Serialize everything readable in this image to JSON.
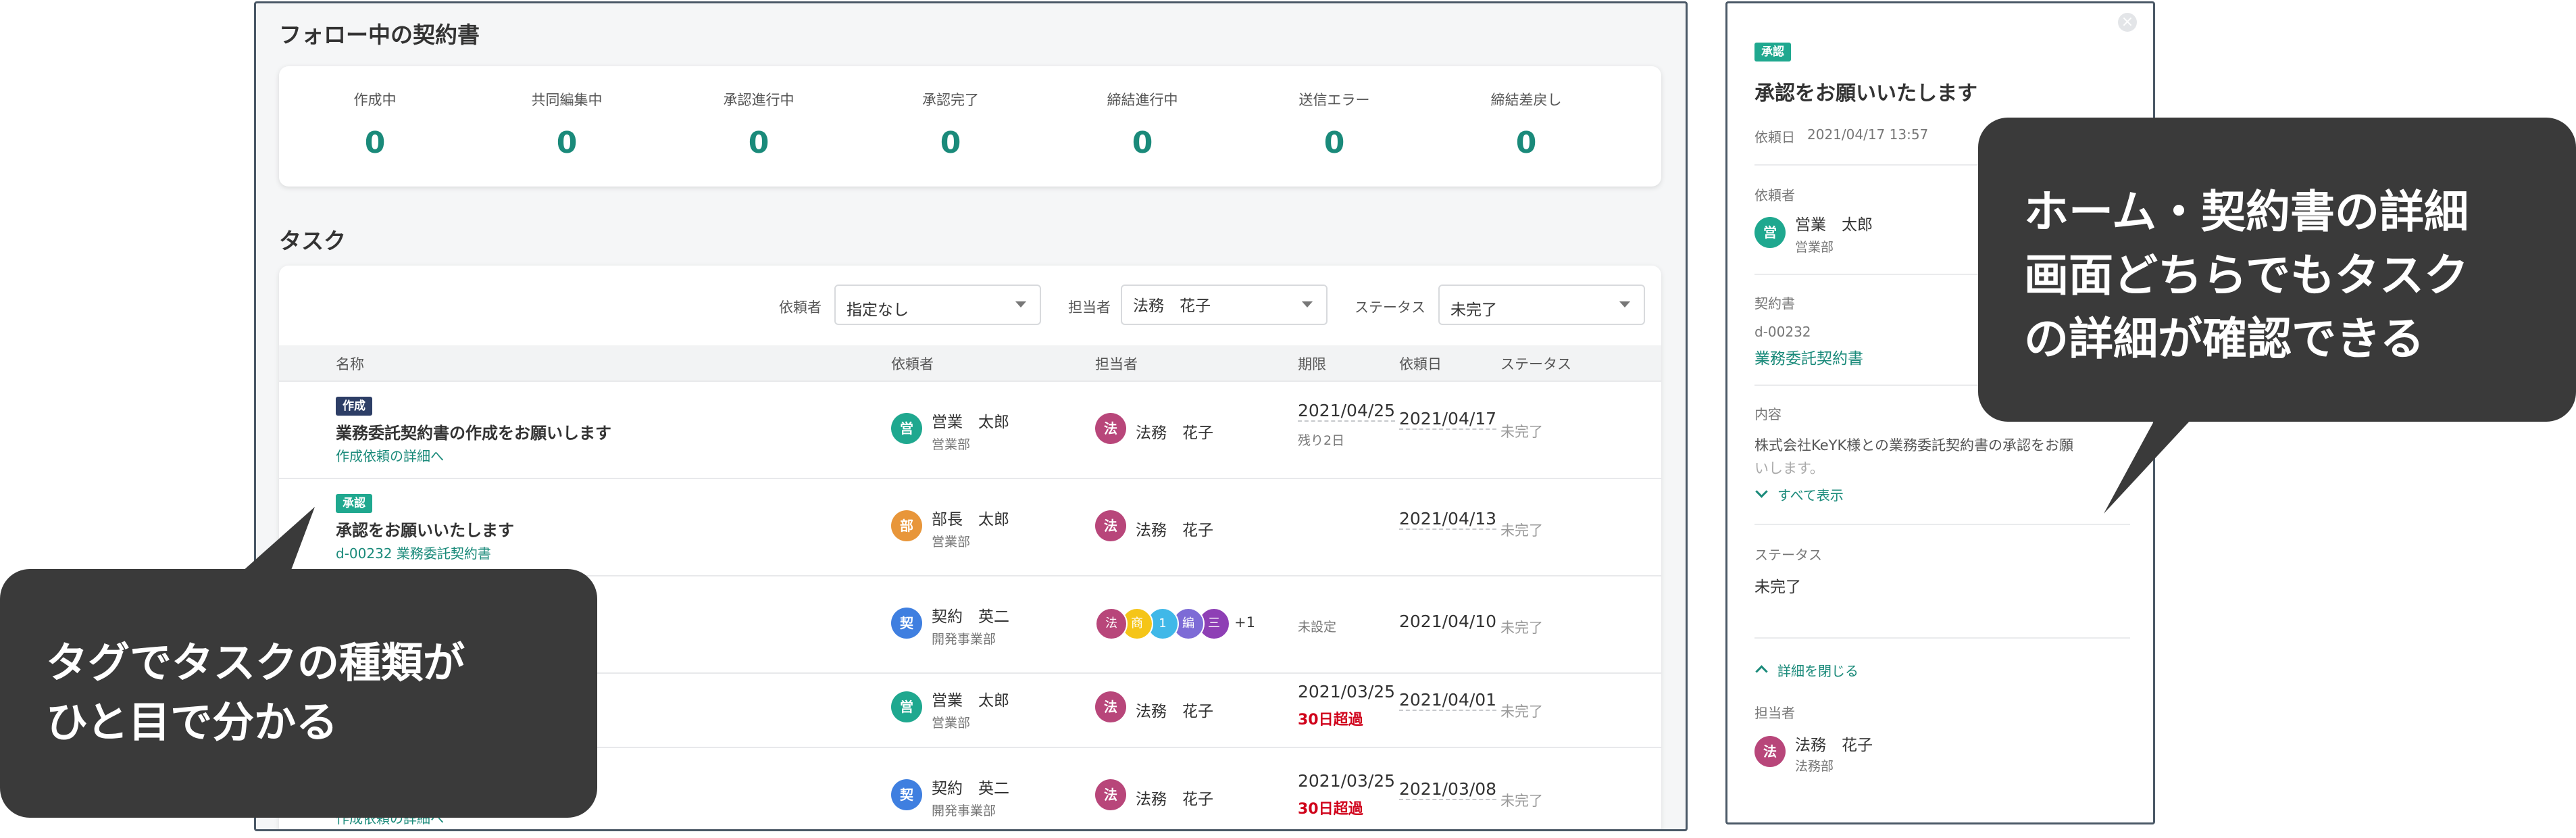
{
  "follow": {
    "title": "フォロー中の契約書",
    "stats": [
      {
        "label": "作成中",
        "count": "0"
      },
      {
        "label": "共同編集中",
        "count": "0"
      },
      {
        "label": "承認進行中",
        "count": "0"
      },
      {
        "label": "承認完了",
        "count": "0"
      },
      {
        "label": "締結進行中",
        "count": "0"
      },
      {
        "label": "送信エラー",
        "count": "0"
      },
      {
        "label": "締結差戻し",
        "count": "0"
      }
    ]
  },
  "tasks": {
    "title": "タスク",
    "filters": {
      "requester_label": "依頼者",
      "requester_value": "指定なし",
      "assignee_label": "担当者",
      "assignee_value": "法務　花子",
      "status_label": "ステータス",
      "status_value": "未完了"
    },
    "columns": [
      "名称",
      "依頼者",
      "担当者",
      "期限",
      "依頼日",
      "ステータス"
    ],
    "rows": [
      {
        "tag": "作成",
        "name": "業務委託契約書の作成をお願いします",
        "link": "作成依頼の詳細へ",
        "req_avatar": "営",
        "req_name": "営業　太郎",
        "req_dept": "営業部",
        "asg_avatar": "法",
        "asg_name": "法務　花子",
        "due": "2021/04/25",
        "due_note": "残り2日",
        "requested": "2021/04/17",
        "status": "未完了"
      },
      {
        "tag": "承認",
        "name": "承認をお願いいたします",
        "link": "d-00232 業務委託契約書",
        "req_avatar": "部",
        "req_name": "部長　太郎",
        "req_dept": "営業部",
        "asg_avatar": "法",
        "asg_name": "法務　花子",
        "requested": "2021/04/13",
        "status": "未完了"
      },
      {
        "req_avatar": "契",
        "req_name": "契約　英二",
        "req_dept": "開発事業部",
        "chips": [
          "法",
          "商",
          "1",
          "編",
          "三"
        ],
        "more": "+1",
        "due": "未設定",
        "requested": "2021/04/10",
        "status": "未完了"
      },
      {
        "req_avatar": "営",
        "req_name": "営業　太郎",
        "req_dept": "営業部",
        "asg_avatar": "法",
        "asg_name": "法務　花子",
        "due": "2021/03/25",
        "overdue": "30日超過",
        "requested": "2021/04/01",
        "status": "未完了"
      },
      {
        "link": "作成依頼の詳細へ",
        "req_avatar": "契",
        "req_name": "契約　英二",
        "req_dept": "開発事業部",
        "asg_avatar": "法",
        "asg_name": "法務　花子",
        "due": "2021/03/25",
        "overdue": "30日超過",
        "requested": "2021/03/08",
        "status": "未完了"
      }
    ]
  },
  "detail": {
    "tag": "承認",
    "title": "承認をお願いいたします",
    "request_date_label": "依頼日",
    "request_date": "2021/04/17 13:57",
    "requester_label": "依頼者",
    "requester_avatar": "営",
    "requester_name": "営業　太郎",
    "requester_dept": "営業部",
    "contract_label": "契約書",
    "contract_id": "d-00232",
    "contract_name": "業務委託契約書",
    "content_label": "内容",
    "content_line1": "株式会社KeYK様との業務委託契約書の承認をお願",
    "content_line2": "いします。",
    "show_all": "すべて表示",
    "status_label": "ステータス",
    "status_value": "未完了",
    "close_details": "詳細を閉じる",
    "assignee_label": "担当者",
    "assignee_avatar": "法",
    "assignee_name": "法務　花子",
    "assignee_dept": "法務部"
  },
  "callouts": {
    "left_line1": "タグでタスクの種類が",
    "left_line2": "ひと目で分かる",
    "right_line1": "ホーム・契約書の詳細",
    "right_line2": "画面どちらでもタスク",
    "right_line3": "の詳細が確認できる"
  },
  "colors": {
    "accent": "#1a8a7a",
    "tag_create": "#2d3e66",
    "tag_approve": "#1fa88f",
    "overdue": "#d0021b",
    "avatar_sales": "#1fa88f",
    "avatar_manager": "#e8963a",
    "avatar_contract": "#3f7fe0",
    "avatar_legal": "#b8467a"
  }
}
